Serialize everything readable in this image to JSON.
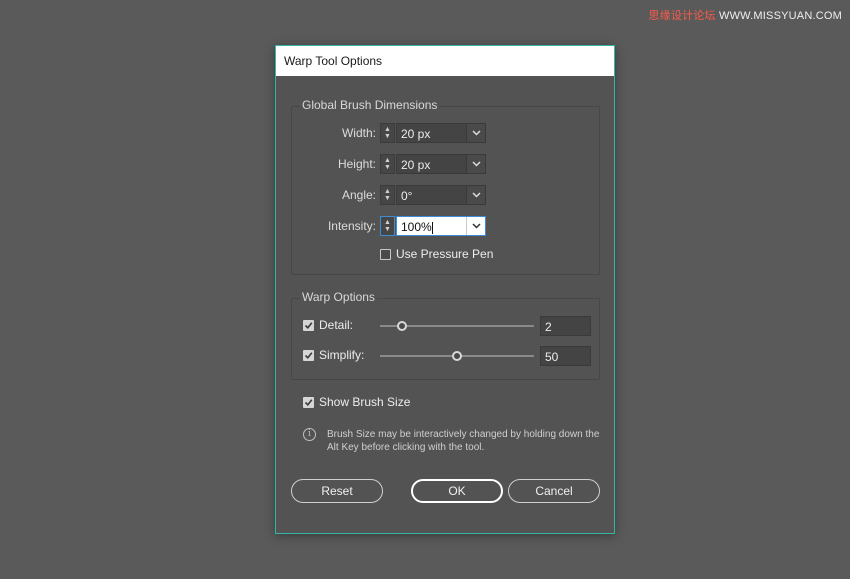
{
  "watermark": {
    "text_a": "思缘设计论坛",
    "text_b": "WWW.MISSYUAN.COM"
  },
  "dialog": {
    "title": "Warp Tool Options",
    "global_brush": {
      "title": "Global Brush Dimensions",
      "fields": [
        {
          "label": "Width:",
          "value": "20 px"
        },
        {
          "label": "Height:",
          "value": "20 px"
        },
        {
          "label": "Angle:",
          "value": "0°"
        },
        {
          "label": "Intensity:",
          "value": "100%"
        }
      ],
      "pressure_pen": {
        "label": "Use Pressure Pen",
        "checked": false
      }
    },
    "warp_options": {
      "title": "Warp Options",
      "detail": {
        "label": "Detail:",
        "checked": true,
        "value": "2",
        "level": 0.14
      },
      "simplify": {
        "label": "Simplify:",
        "checked": true,
        "value": "50",
        "level": 0.5
      }
    },
    "show_brush_size": {
      "label": "Show Brush Size",
      "checked": true
    },
    "info_text": "Brush Size may be interactively changed by holding down the Alt Key before clicking with the tool.",
    "buttons": {
      "reset": "Reset",
      "ok": "OK",
      "cancel": "Cancel"
    },
    "colors": {
      "accent_border": "#2fb6a6",
      "panel": "#535353",
      "background": "#5a5a5a"
    }
  }
}
